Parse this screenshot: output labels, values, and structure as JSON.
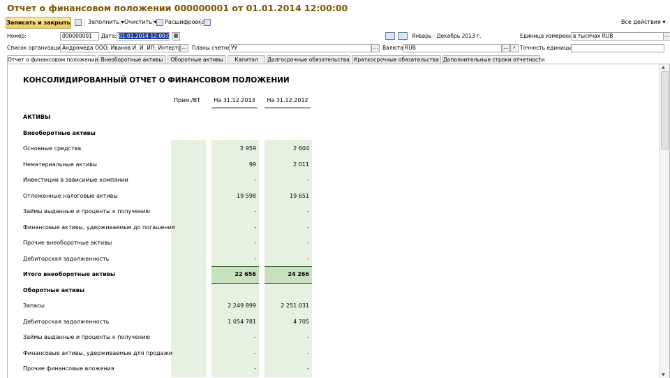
{
  "window": {
    "title": "Отчет о финансовом положении 000000001 от 01.01.2014 12:00:00"
  },
  "toolbar": {
    "save_close": "Записать и закрыть",
    "fill": "Заполнить",
    "clear": "Очистить",
    "decode": "Расшифровка",
    "all_actions": "Все действия"
  },
  "form": {
    "number_label": "Номер:",
    "number": "000000001",
    "date_label": "Дата:",
    "date": "01.01.2014 12:00:00",
    "period": "Январь - Декабрь 2013 г.",
    "unit_label": "Единица измерения:",
    "unit": "в тысячах RUB",
    "orgs_label": "Список организаций:",
    "orgs": "Андромеда ООО; Иванов И. И. ИП; Интертрейд С",
    "accounts_label": "Планы счетов:",
    "accounts": "УУ",
    "currency_label": "Валюта:",
    "currency": "RUB",
    "precision_label": "Точность единицы:",
    "precision": ""
  },
  "tabs": [
    "Отчет о финансовом положении",
    "Внеоборотные активы",
    "Оборотные активы",
    "Капитал",
    "Долгосрочные обязательства",
    "Краткосрочные обязательства",
    "Дополнительные строки отчетности"
  ],
  "report": {
    "title": "КОНСОЛИДИРОВАННЫЙ ОТЧЕТ О ФИНАНСОВОМ ПОЛОЖЕНИИ",
    "col_note": "Прим./ВТ",
    "col_2013": "На 31.12.2013",
    "col_2012": "На 31.12.2012",
    "rows": [
      {
        "label": "АКТИВЫ",
        "v1": "",
        "v2": "",
        "style": "section"
      },
      {
        "label": "Внеоборотные активы",
        "v1": "",
        "v2": "",
        "style": "section"
      },
      {
        "label": "Основные средства",
        "v1": "2 959",
        "v2": "2 604",
        "style": "item"
      },
      {
        "label": "Нематериальные активы",
        "v1": "99",
        "v2": "2 011",
        "style": "item"
      },
      {
        "label": "Инвестиции в зависимые компании",
        "v1": "-",
        "v2": "-",
        "style": "item"
      },
      {
        "label": "Отложенные налоговые активы",
        "v1": "19 598",
        "v2": "19 651",
        "style": "item"
      },
      {
        "label": "Займы выданные и проценты к получению",
        "v1": "-",
        "v2": "-",
        "style": "item"
      },
      {
        "label": "Финансовые активы, удерживаемые до погашения",
        "v1": "-",
        "v2": "-",
        "style": "item"
      },
      {
        "label": "Прочие внеоборотные активы",
        "v1": "-",
        "v2": "-",
        "style": "item"
      },
      {
        "label": "Дебиторская задолженность",
        "v1": "-",
        "v2": "-",
        "style": "item"
      },
      {
        "label": "Итого внеоборотные активы",
        "v1": "22 656",
        "v2": "24 266",
        "style": "total"
      },
      {
        "label": "Оборотные активы",
        "v1": "",
        "v2": "",
        "style": "section"
      },
      {
        "label": "Запасы",
        "v1": "2 249 899",
        "v2": "2 251 031",
        "style": "item"
      },
      {
        "label": "Дебиторская задолженность",
        "v1": "1 054 781",
        "v2": "4 705",
        "style": "item"
      },
      {
        "label": "Займы выданные и проценты к получению",
        "v1": "-",
        "v2": "-",
        "style": "item"
      },
      {
        "label": "Финансовые активы, удерживаемые для продажи",
        "v1": "-",
        "v2": "-",
        "style": "item"
      },
      {
        "label": "Прочие финансовые вложения",
        "v1": "-",
        "v2": "-",
        "style": "item"
      }
    ]
  }
}
